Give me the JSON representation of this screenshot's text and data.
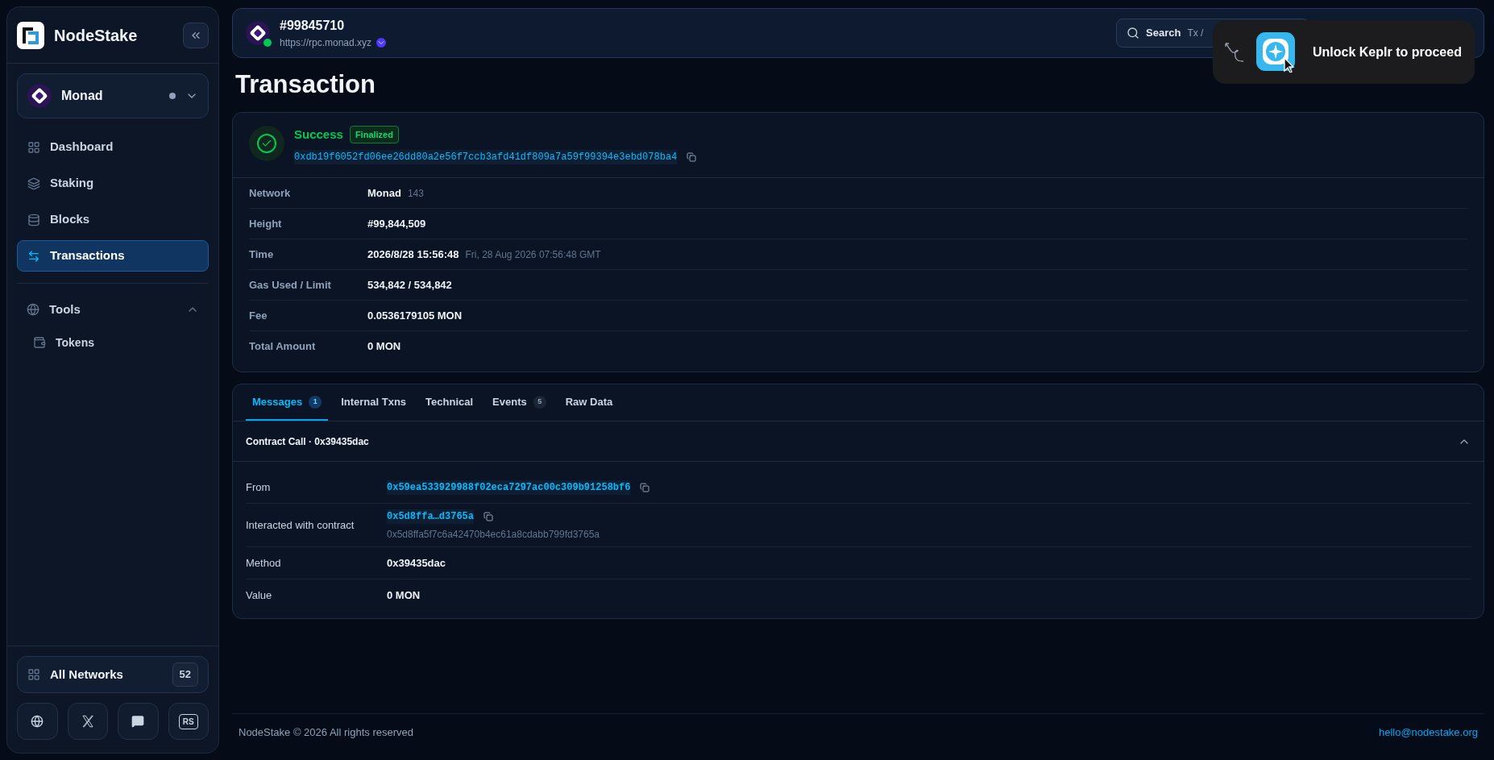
{
  "sidebar": {
    "brand": "NodeStake",
    "network_selector": {
      "name": "Monad",
      "online": false
    },
    "nav": [
      {
        "label": "Dashboard",
        "kind": "grid",
        "selected": false
      },
      {
        "label": "Staking",
        "kind": "stake",
        "selected": false
      },
      {
        "label": "Blocks",
        "kind": "blocks",
        "selected": false
      },
      {
        "label": "Transactions",
        "kind": "arrows",
        "selected": true
      }
    ],
    "tools": {
      "label": "Tools",
      "expanded": true,
      "children": [
        {
          "label": "Tokens"
        }
      ]
    },
    "all_networks": {
      "label": "All Networks",
      "count": "52"
    },
    "social_buttons": [
      {
        "kind": "globe"
      },
      {
        "kind": "x"
      },
      {
        "kind": "discord"
      },
      {
        "kind": "text",
        "label": "RS"
      }
    ]
  },
  "header": {
    "block": "#99845710",
    "rpc": "https://rpc.monad.xyz",
    "connected": true,
    "search": {
      "placeholder": "Search",
      "hint": "Tx /"
    }
  },
  "popup": {
    "text": "Unlock Keplr to proceed"
  },
  "page_title": "Transaction",
  "summary": {
    "status": "Success",
    "badge": "Finalized",
    "hash": "0xdb19f6052fd06ee26dd80a2e56f7ccb3afd41df809a7a59f99394e3ebd078ba4",
    "rows": [
      {
        "label": "Network",
        "value": "Monad",
        "extra": "143"
      },
      {
        "label": "Height",
        "value": "#99,844,509"
      },
      {
        "label": "Time",
        "value": "2026/8/28 15:56:48",
        "extra": "Fri, 28 Aug 2026 07:56:48 GMT"
      },
      {
        "label": "Gas Used / Limit",
        "value": "534,842 / 534,842"
      },
      {
        "label": "Fee",
        "value": "0.0536179105 MON"
      },
      {
        "label": "Total Amount",
        "value": "0 MON"
      }
    ]
  },
  "tabs": [
    {
      "label": "Messages",
      "count": "1",
      "selected": true
    },
    {
      "label": "Internal Txns",
      "selected": false
    },
    {
      "label": "Technical",
      "selected": false
    },
    {
      "label": "Events",
      "count": "5",
      "selected": false
    },
    {
      "label": "Raw Data",
      "selected": false
    }
  ],
  "message": {
    "title": "Contract Call · 0x39435dac",
    "expanded": true,
    "rows": [
      {
        "label": "From",
        "kind": "address",
        "value": "0x59ea533929988f02eca7297ac00c309b91258bf6"
      },
      {
        "label": "Interacted with contract",
        "kind": "contract",
        "value": "0x5d8ffa…d3765a",
        "full": "0x5d8ffa5f7c6a42470b4ec61a8cdabb799fd3765a"
      },
      {
        "label": "Method",
        "kind": "plain",
        "value": "0x39435dac"
      },
      {
        "label": "Value",
        "kind": "plain",
        "value": "0 MON"
      }
    ]
  },
  "footer": {
    "copyright": "NodeStake © 2026 All rights reserved",
    "email": "hello@nodestake.org"
  }
}
